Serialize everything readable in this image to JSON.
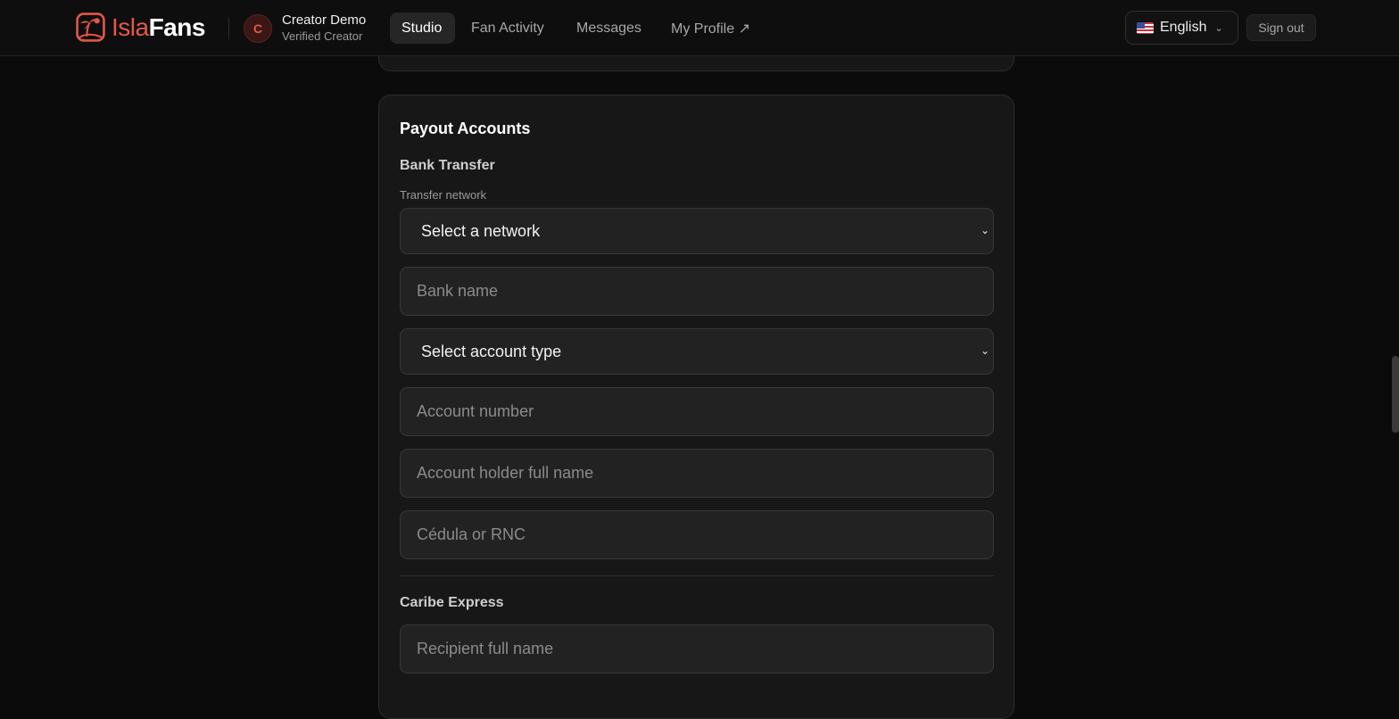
{
  "brand": {
    "name_part1": "Isla",
    "name_part2": "Fans",
    "icon": "palm-beach-logo-icon"
  },
  "user": {
    "initial": "C",
    "name": "Creator Demo",
    "role": "Verified Creator"
  },
  "nav": [
    {
      "label": "Studio",
      "active": true
    },
    {
      "label": "Fan Activity",
      "active": false
    },
    {
      "label": "Messages",
      "active": false
    },
    {
      "label": "My Profile ↗",
      "active": false
    }
  ],
  "language": {
    "label": "English",
    "flag": "us-flag-icon"
  },
  "signout_label": "Sign out",
  "payout": {
    "title": "Payout Accounts",
    "bank": {
      "title": "Bank Transfer",
      "network_label": "Transfer network",
      "network_select": "Select a network",
      "bank_name_placeholder": "Bank name",
      "account_type_select": "Select account type",
      "account_number_placeholder": "Account number",
      "holder_placeholder": "Account holder full name",
      "cedula_placeholder": "Cédula or RNC"
    },
    "caribe": {
      "title": "Caribe Express",
      "recipient_placeholder": "Recipient full name"
    }
  },
  "colors": {
    "accent": "#e4574a",
    "background": "#0b0b0b",
    "card": "#171717",
    "input": "#222222"
  }
}
